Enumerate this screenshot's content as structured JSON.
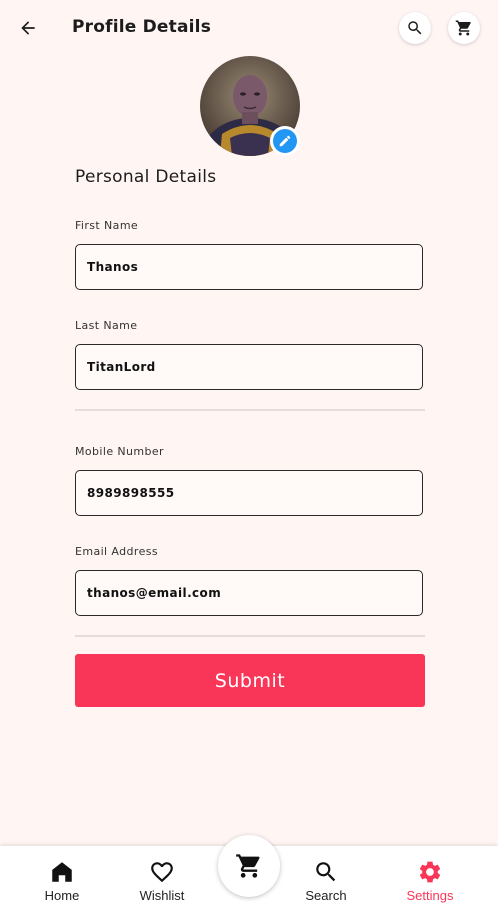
{
  "header": {
    "title": "Profile Details",
    "back_icon": "arrow-left-icon",
    "search_icon": "search-icon",
    "cart_icon": "cart-icon"
  },
  "profile": {
    "avatar_alt": "Profile photo",
    "edit_icon": "pencil-icon"
  },
  "form": {
    "section_title": "Personal Details",
    "first_name": {
      "label": "First Name",
      "value": "Thanos"
    },
    "last_name": {
      "label": "Last Name",
      "value": "TitanLord"
    },
    "mobile": {
      "label": "Mobile Number",
      "value": "8989898555"
    },
    "email": {
      "label": "Email Address",
      "value": "thanos@email.com"
    },
    "submit_label": "Submit"
  },
  "bottom_nav": {
    "items": [
      {
        "label": "Home",
        "icon": "home-icon"
      },
      {
        "label": "Wishlist",
        "icon": "heart-icon"
      },
      {
        "label": "Search",
        "icon": "search-icon"
      },
      {
        "label": "Settings",
        "icon": "gear-icon",
        "active": true
      }
    ],
    "center_icon": "cart-icon"
  },
  "colors": {
    "accent": "#f93658",
    "background": "#fff5f3",
    "edit_badge": "#2196f3"
  }
}
